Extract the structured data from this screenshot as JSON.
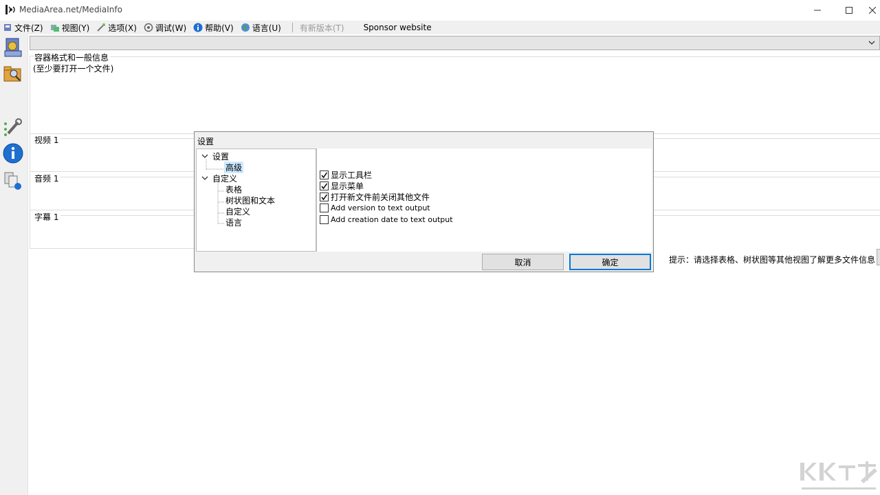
{
  "window": {
    "title": "MediaArea.net/MediaInfo"
  },
  "menu": {
    "items": [
      {
        "label": "文件(Z)",
        "icon": "file-icon"
      },
      {
        "label": "视图(Y)",
        "icon": "view-icon"
      },
      {
        "label": "选项(X)",
        "icon": "options-icon"
      },
      {
        "label": "调试(W)",
        "icon": "debug-icon"
      },
      {
        "label": "帮助(V)",
        "icon": "help-icon"
      },
      {
        "label": "语言(U)",
        "icon": "globe-icon"
      }
    ],
    "newer_version": "有新版本(T)",
    "sponsor": "Sponsor website"
  },
  "main": {
    "general_title": "容器格式和一般信息",
    "general_subtitle": "(至少要打开一个文件)",
    "video_title": "视频 1",
    "audio_title": "音频 1",
    "subtitle_title": "字幕 1",
    "hint": "提示：请选择表格、树状图等其他视图了解更多文件信息"
  },
  "dialog": {
    "title": "设置",
    "tree": {
      "settings": "设置",
      "advanced": "高级",
      "customize": "自定义",
      "sheet": "表格",
      "tree_text": "树状图和文本",
      "custom": "自定义",
      "language": "语言"
    },
    "options": [
      {
        "label": "显示工具栏",
        "checked": true
      },
      {
        "label": "显示菜单",
        "checked": true
      },
      {
        "label": "打开新文件前关闭其他文件",
        "checked": true
      },
      {
        "label": "Add version to text output",
        "checked": false
      },
      {
        "label": "Add creation date to text output",
        "checked": false
      }
    ],
    "cancel_label": "取消",
    "ok_label": "确定"
  },
  "colors": {
    "accent": "#0078d7",
    "selection": "#cce8ff",
    "chrome": "#f0f0f0"
  }
}
